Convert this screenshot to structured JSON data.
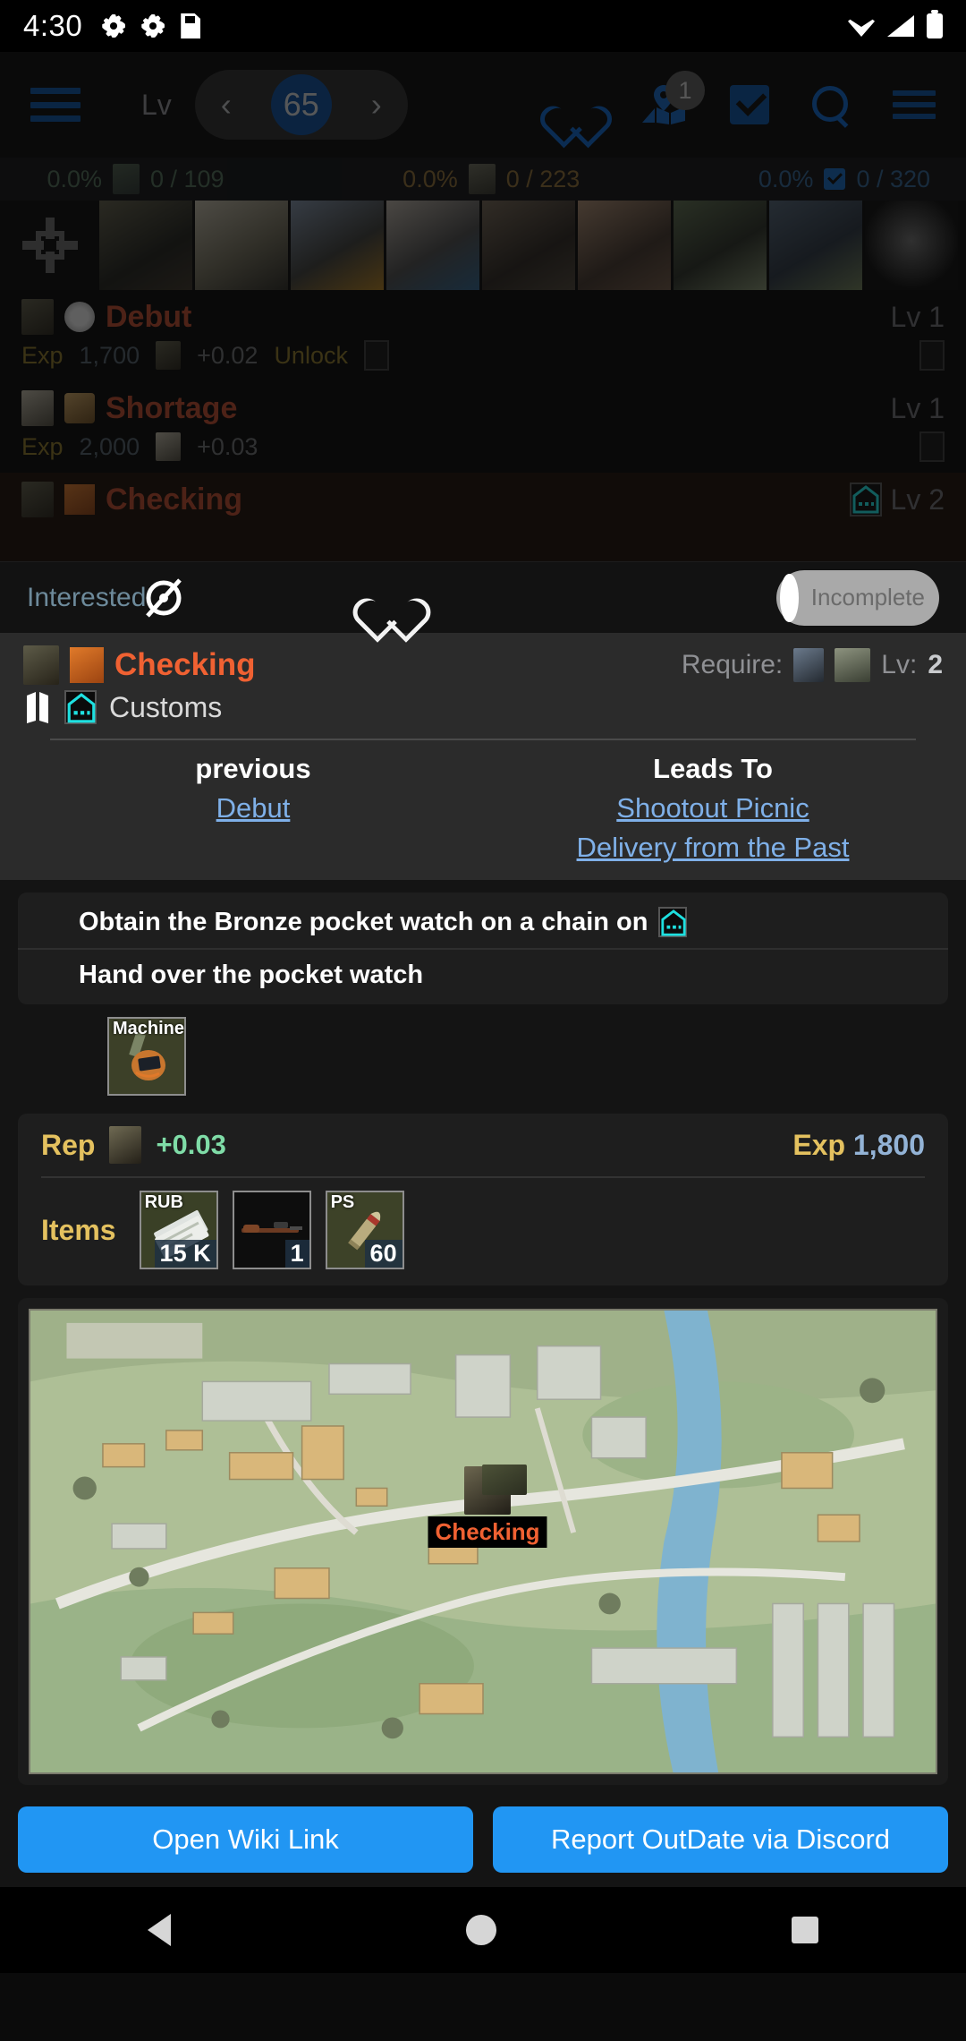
{
  "statusbar": {
    "time": "4:30",
    "icons": [
      "gear-icon",
      "gear-icon",
      "sd-card-icon"
    ],
    "right_icons": [
      "wifi-icon",
      "signal-icon",
      "battery-icon"
    ]
  },
  "toolbar": {
    "menu_icon": "hamburger-menu-icon",
    "level_label": "Lv",
    "level_value": "65",
    "prev_arrow": "‹",
    "next_arrow": "›",
    "favorite_icon": "heart-icon",
    "map_icon": "map-pin-icon",
    "map_badge": "1",
    "check_icon": "checkbox-checked-icon",
    "search_icon": "search-icon",
    "overflow_icon": "hamburger-menu-icon",
    "accent": "#0a4f9e"
  },
  "stats": [
    {
      "percent": "0.0%",
      "fraction": "0 / 109",
      "icon": "trader-avatar-icon",
      "color": "#4d6b55"
    },
    {
      "percent": "0.0%",
      "fraction": "0 / 223",
      "icon": "item-crate-icon",
      "color": "#8a6a33"
    },
    {
      "percent": "0.0%",
      "fraction": "0 / 320",
      "icon": "checkbox-checked-icon",
      "color": "#2f6190"
    }
  ],
  "traders": {
    "all_icon": "crosshair-icon",
    "items": [
      {
        "name": "prapor"
      },
      {
        "name": "therapist"
      },
      {
        "name": "skier"
      },
      {
        "name": "peacekeeper"
      },
      {
        "name": "mechanic"
      },
      {
        "name": "ragman"
      },
      {
        "name": "jaeger"
      },
      {
        "name": "fence"
      },
      {
        "name": "lightkeeper"
      }
    ]
  },
  "quest_list": [
    {
      "name": "Debut",
      "level": "Lv 1",
      "exp_label": "Exp",
      "exp": "1,700",
      "rep": "+0.02",
      "extra_label": "Unlock",
      "active": false,
      "trader_icon": "prapor-avatar-icon"
    },
    {
      "name": "Shortage",
      "level": "Lv 1",
      "exp_label": "Exp",
      "exp": "2,000",
      "rep": "+0.03",
      "extra_label": "",
      "active": false,
      "trader_icon": "therapist-avatar-icon"
    },
    {
      "name": "Checking",
      "level": "Lv 2",
      "exp_label": "Exp",
      "exp": "1,800",
      "rep": "+0.03",
      "extra_label": "",
      "active": true,
      "trader_icon": "prapor-avatar-icon"
    }
  ],
  "filterbar": {
    "interested_label": "Interested",
    "hide_icon": "eye-off-icon",
    "favorite_icon": "heart-icon",
    "toggle_label": "Incomplete",
    "toggle_on": false
  },
  "detail": {
    "title": "Checking",
    "title_color": "#f06132",
    "trader_icon": "prapor-avatar-icon",
    "task_icon": "quest-board-icon",
    "require_label": "Require:",
    "require_level_label": "Lv:",
    "require_level": "2",
    "map_icon": "map-fold-icon",
    "location_icon": "customs-icon",
    "location": "Customs",
    "chain": {
      "previous_header": "previous",
      "previous_links": [
        "Debut"
      ],
      "leads_header": "Leads To",
      "leads_links": [
        "Shootout Picnic",
        "Delivery from the Past"
      ]
    },
    "objectives": [
      {
        "text": "Obtain the Bronze pocket watch on a chain on",
        "location_icon": "customs-icon"
      },
      {
        "text": "Hand over the pocket watch",
        "location_icon": ""
      }
    ],
    "objective_items": [
      {
        "label": "Machinery",
        "qty": "",
        "icon": "pocket-watch-icon"
      }
    ],
    "rewards": {
      "rep_label": "Rep",
      "rep_trader_icon": "prapor-avatar-icon",
      "rep_value": "+0.03",
      "exp_label": "Exp",
      "exp_value": "1,800",
      "items_label": "Items",
      "items": [
        {
          "label": "RUB",
          "qty": "15 K",
          "icon": "roubles-icon"
        },
        {
          "label": "",
          "qty": "1",
          "icon": "rifle-icon"
        },
        {
          "label": "PS",
          "qty": "60",
          "icon": "ammo-icon"
        }
      ]
    },
    "map_marker": {
      "label": "Checking",
      "trader_icon": "prapor-avatar-icon",
      "item_icon": "pocket-watch-icon"
    }
  },
  "buttons": {
    "wiki": "Open Wiki Link",
    "report": "Report OutDate via Discord",
    "color": "#2196f3"
  },
  "navbar": {
    "back_icon": "triangle-back-icon",
    "home_icon": "circle-home-icon",
    "recents_icon": "square-recents-icon"
  }
}
